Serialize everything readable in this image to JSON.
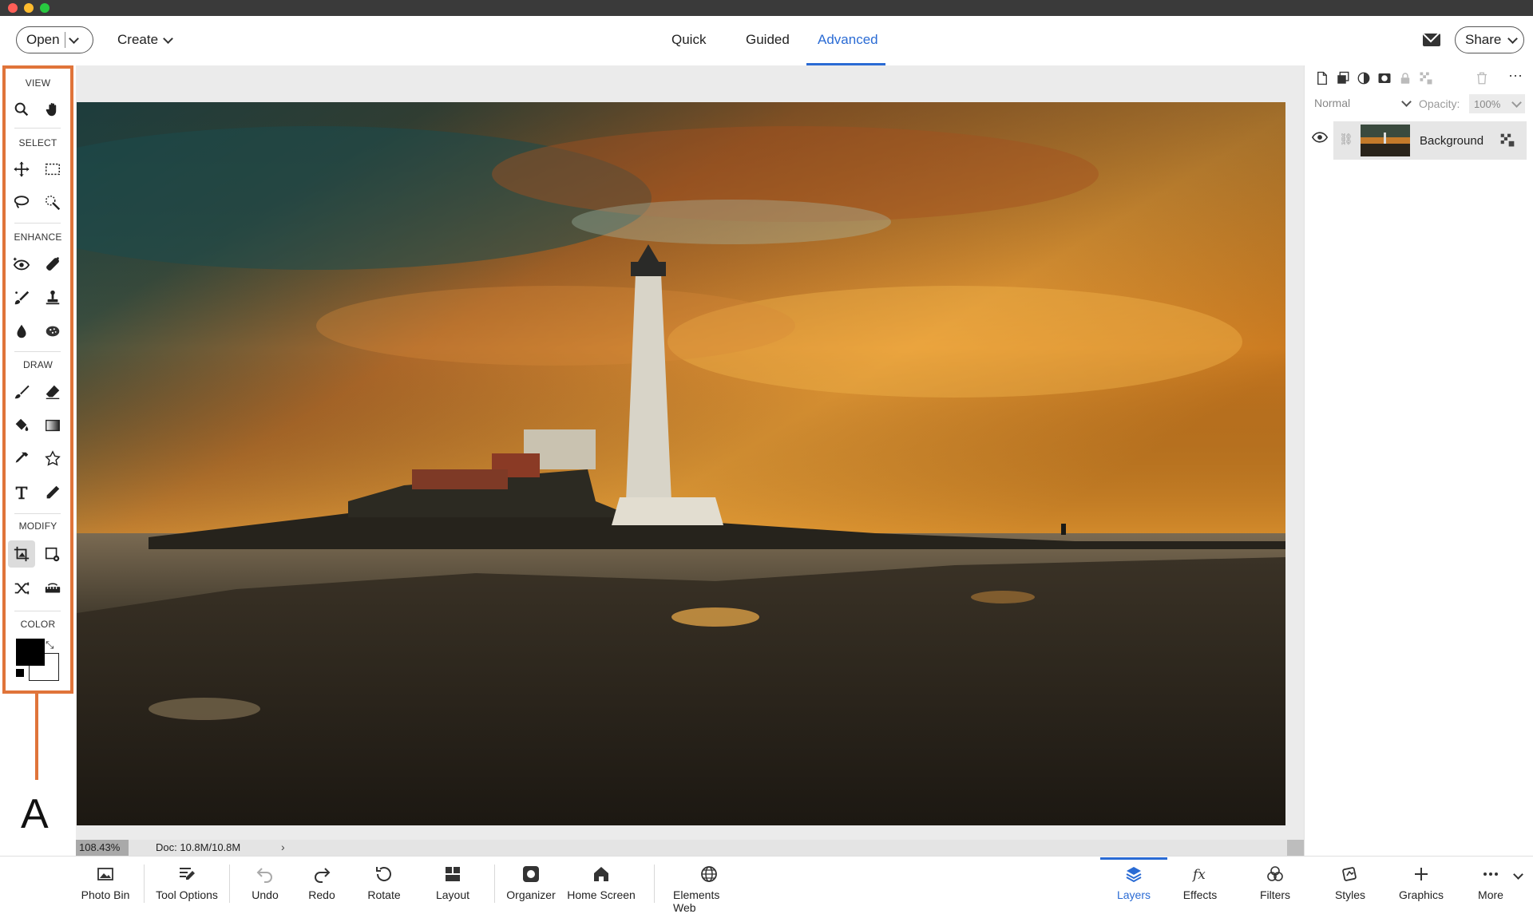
{
  "window": {
    "traffic_colors": [
      "#ff5f57",
      "#febc2e",
      "#28c840"
    ]
  },
  "topbar": {
    "open_label": "Open",
    "create_label": "Create",
    "modes": [
      "Quick",
      "Guided",
      "Advanced"
    ],
    "active_mode": "Advanced",
    "share_label": "Share"
  },
  "tools": {
    "sections": [
      "VIEW",
      "SELECT",
      "ENHANCE",
      "DRAW",
      "MODIFY",
      "COLOR"
    ],
    "items": [
      "zoom-icon",
      "hand-icon",
      "move-icon",
      "marquee-icon",
      "lasso-icon",
      "quick-selection-icon",
      "red-eye-icon",
      "spot-healing-icon",
      "smart-brush-icon",
      "clone-stamp-icon",
      "blur-icon",
      "sponge-icon",
      "brush-icon",
      "eraser-icon",
      "paint-bucket-icon",
      "gradient-icon",
      "eyedropper-icon",
      "custom-shape-icon",
      "type-icon",
      "pencil-icon",
      "crop-icon",
      "recompose-icon",
      "content-aware-move-icon",
      "straighten-icon"
    ],
    "foreground_color": "#000000",
    "background_color": "#ffffff",
    "accent": "#e0743a"
  },
  "callout": {
    "label": "A"
  },
  "status": {
    "zoom": "108.43%",
    "doc": "Doc: 10.8M/10.8M",
    "arrow": "›"
  },
  "layers_panel": {
    "blend_mode": "Normal",
    "opacity_label": "Opacity:",
    "opacity_value": "100%",
    "layer_name": "Background"
  },
  "taskbar": {
    "left": [
      "Photo Bin",
      "Tool Options",
      "Undo",
      "Redo",
      "Rotate",
      "Layout",
      "Organizer",
      "Home Screen",
      "Elements Web"
    ],
    "right": [
      "Layers",
      "Effects",
      "Filters",
      "Styles",
      "Graphics",
      "More"
    ],
    "active": "Layers",
    "accent": "#2a6bd4"
  }
}
